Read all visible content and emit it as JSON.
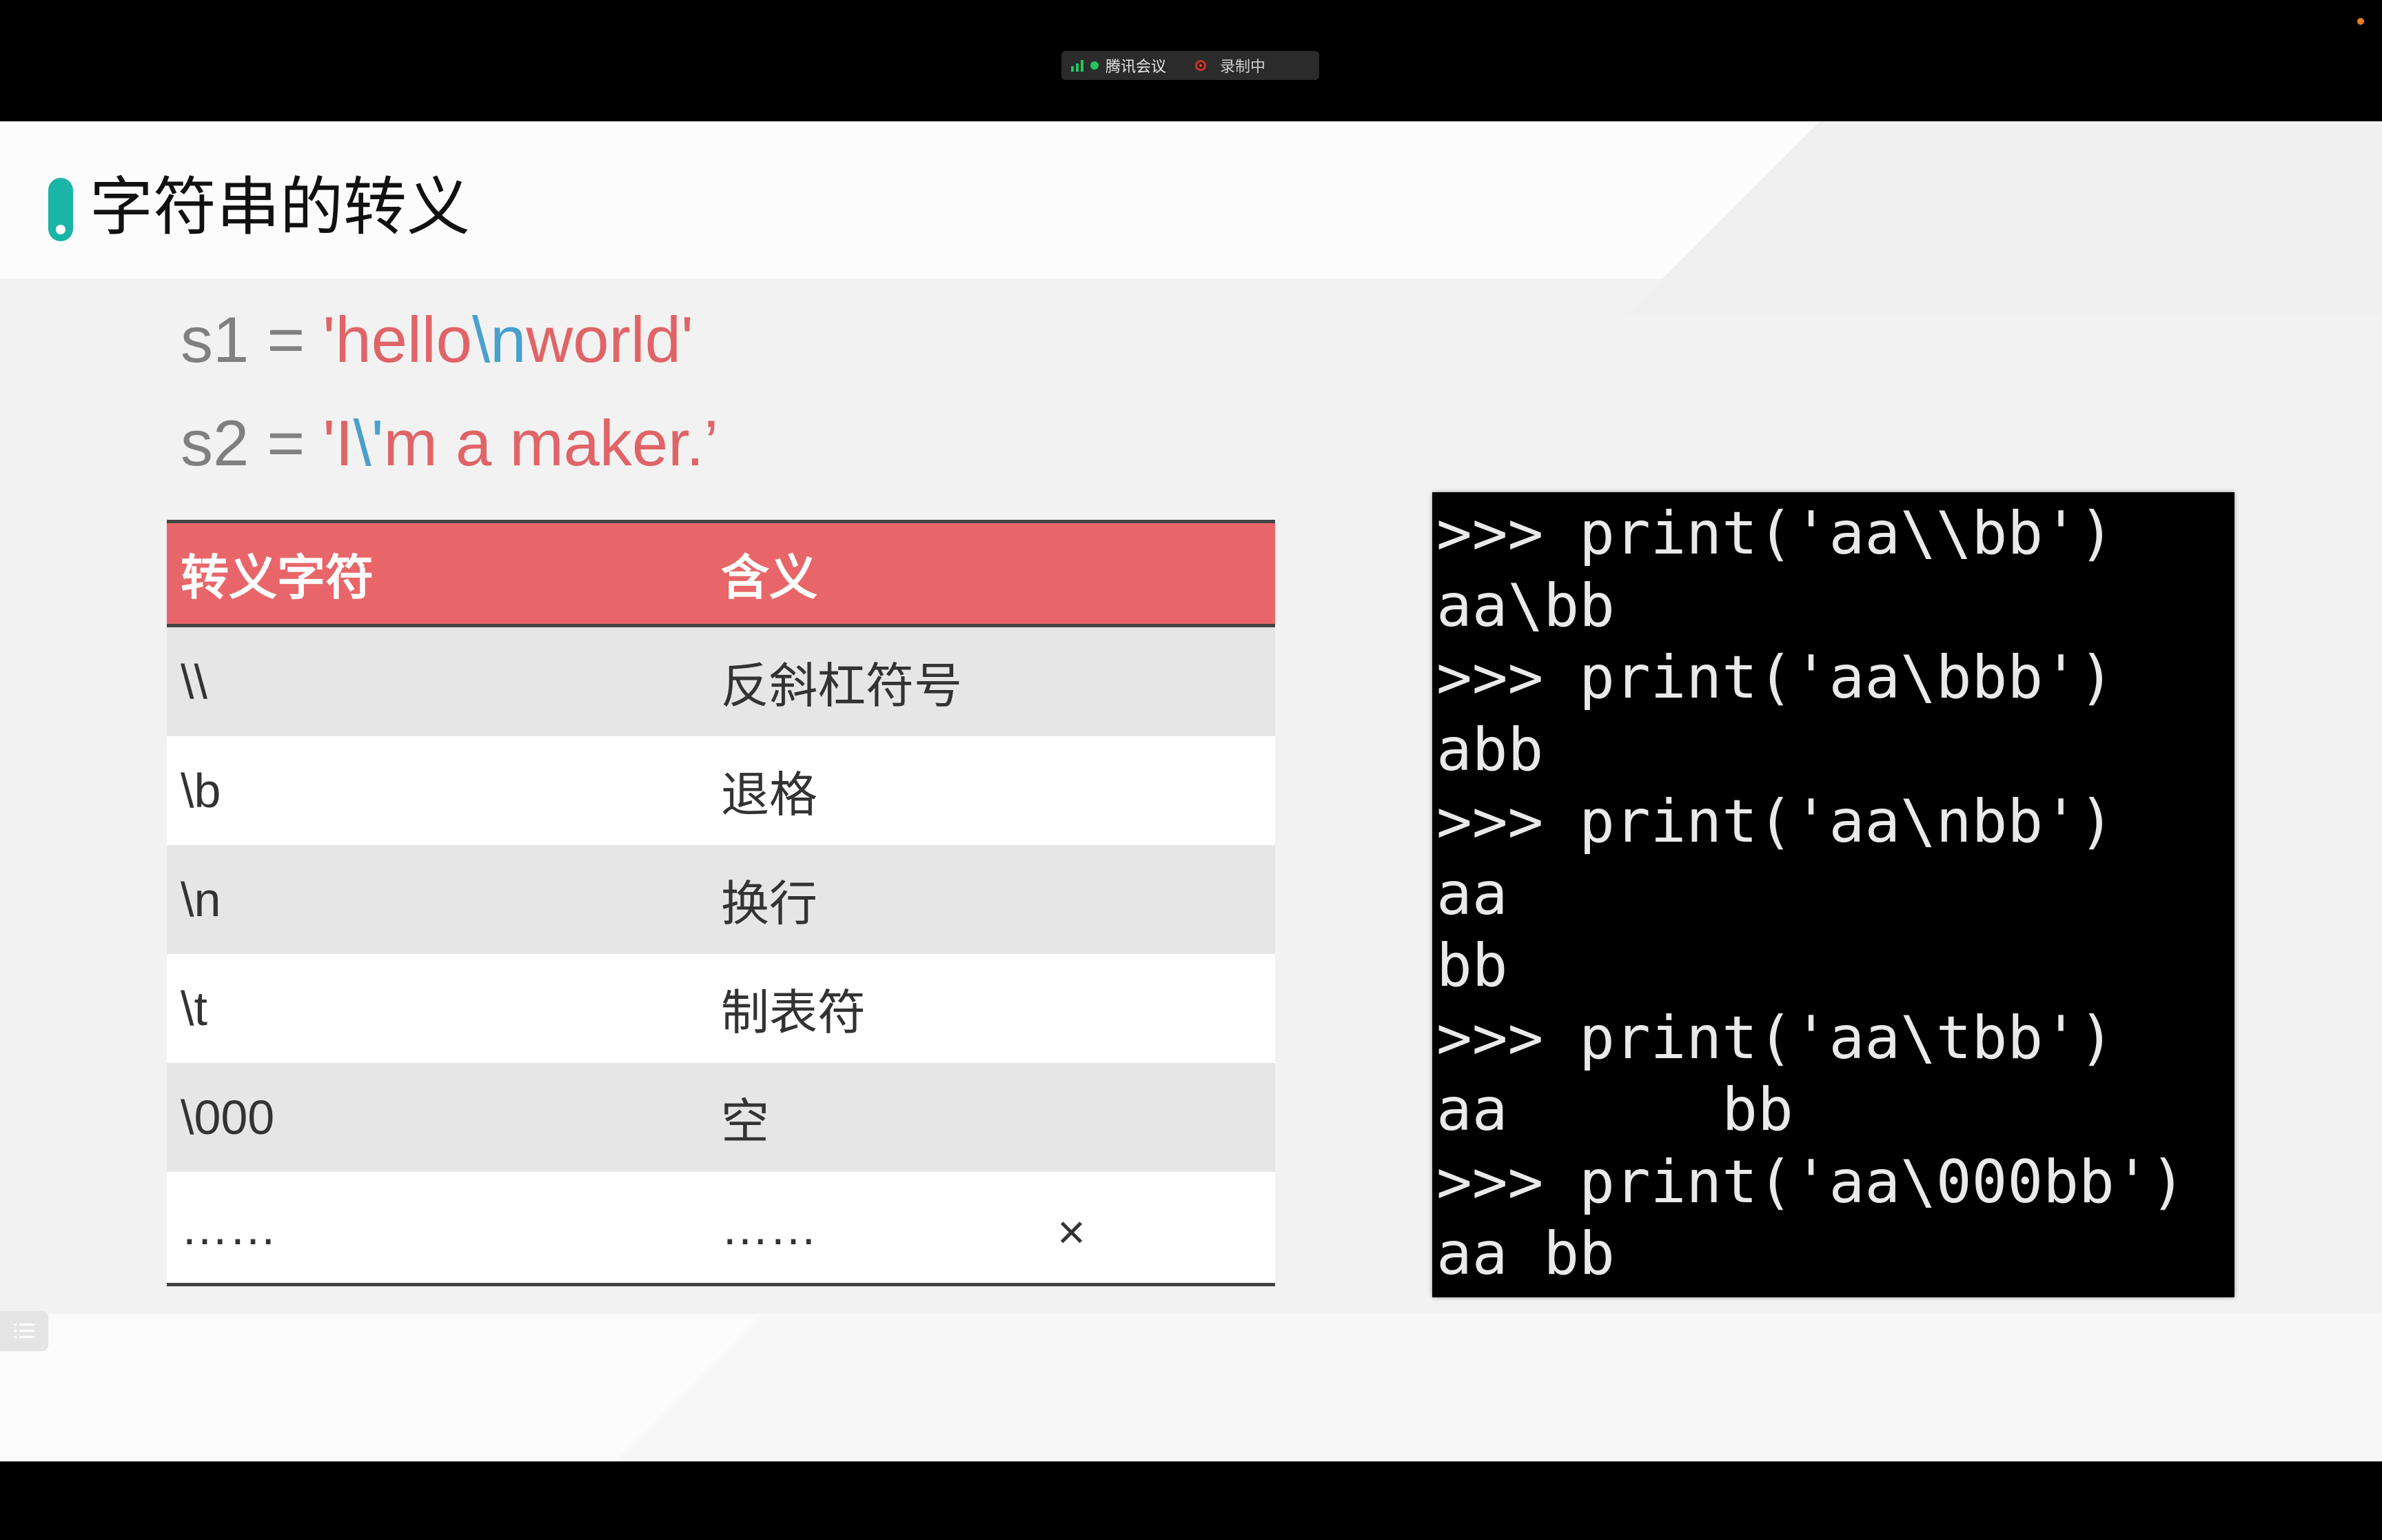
{
  "meeting_bar": {
    "app_name": "腾讯会议",
    "recording_label": "录制中",
    "colors": {
      "signal": "#22c55e",
      "record": "#c0392b"
    }
  },
  "slide": {
    "title": "字符串的转义",
    "accent_color": "#1ab5a6",
    "code_lines": [
      {
        "prefix": "s1 = ",
        "parts": [
          {
            "text": "'hello",
            "color": "red"
          },
          {
            "text": "\\n",
            "color": "blue"
          },
          {
            "text": "world'",
            "color": "red"
          }
        ]
      },
      {
        "prefix": "s2 = ",
        "parts": [
          {
            "text": "'I",
            "color": "red"
          },
          {
            "text": "\\'",
            "color": "blue"
          },
          {
            "text": "m a maker.’",
            "color": "red"
          }
        ]
      }
    ],
    "table": {
      "header_color": "#e86669",
      "headers": [
        "转义字符",
        "含义"
      ],
      "rows": [
        [
          "\\\\",
          "反斜杠符号"
        ],
        [
          "\\b",
          "退格"
        ],
        [
          "\\n",
          "换行"
        ],
        [
          "\\t",
          "制表符"
        ],
        [
          "\\000",
          "空"
        ],
        [
          "……",
          "……"
        ]
      ]
    },
    "console_text": ">>> print('aa\\\\bb')\naa\\bb\n>>> print('aa\\bbb')\nabb\n>>> print('aa\\nbb')\naa\nbb\n>>> print('aa\\tbb')\naa      bb\n>>> print('aa\\000bb')\naa bb"
  }
}
